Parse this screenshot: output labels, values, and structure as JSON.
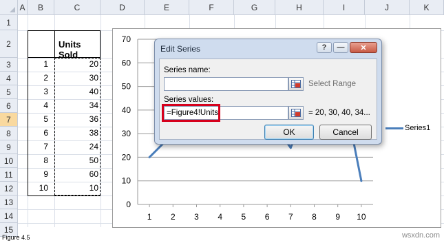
{
  "columns": [
    "A",
    "B",
    "C",
    "D",
    "E",
    "F",
    "G",
    "H",
    "I",
    "J",
    "K"
  ],
  "rows": [
    "1",
    "2",
    "3",
    "4",
    "5",
    "6",
    "7",
    "8",
    "9",
    "10",
    "11",
    "12",
    "13",
    "14",
    "15"
  ],
  "selected_row": "7",
  "table": {
    "header": "Units Sold",
    "index": [
      "1",
      "2",
      "3",
      "4",
      "5",
      "6",
      "7",
      "8",
      "9",
      "10"
    ],
    "values": [
      "20",
      "30",
      "40",
      "34",
      "36",
      "38",
      "24",
      "50",
      "60",
      "10"
    ]
  },
  "chart_data": {
    "type": "line",
    "x": [
      1,
      2,
      3,
      4,
      5,
      6,
      7,
      8,
      9,
      10
    ],
    "series": [
      {
        "name": "Series1",
        "values": [
          20,
          30,
          40,
          34,
          36,
          38,
          24,
          50,
          60,
          10
        ]
      }
    ],
    "ylim": [
      0,
      70
    ],
    "yticks": [
      "0",
      "10",
      "20",
      "30",
      "40",
      "50",
      "60",
      "70"
    ],
    "xticks": [
      "1",
      "2",
      "3",
      "4",
      "5",
      "6",
      "7",
      "8",
      "9",
      "10"
    ],
    "grid": true,
    "legend": "right",
    "color": "#4a7ebb"
  },
  "dialog": {
    "title": "Edit Series",
    "help_btn": "?",
    "minimize_btn": "—",
    "close_btn": "✕",
    "series_name_label": "Series name:",
    "series_name_value": "",
    "select_range": "Select Range",
    "series_values_label": "Series values:",
    "series_values_value": "=Figure4!Units",
    "series_values_preview": "= 20, 30, 40, 34...",
    "ok": "OK",
    "cancel": "Cancel",
    "highlight_color": "#d6001c"
  },
  "footer": "Figure 4.5",
  "watermark": "wsxdn.com"
}
